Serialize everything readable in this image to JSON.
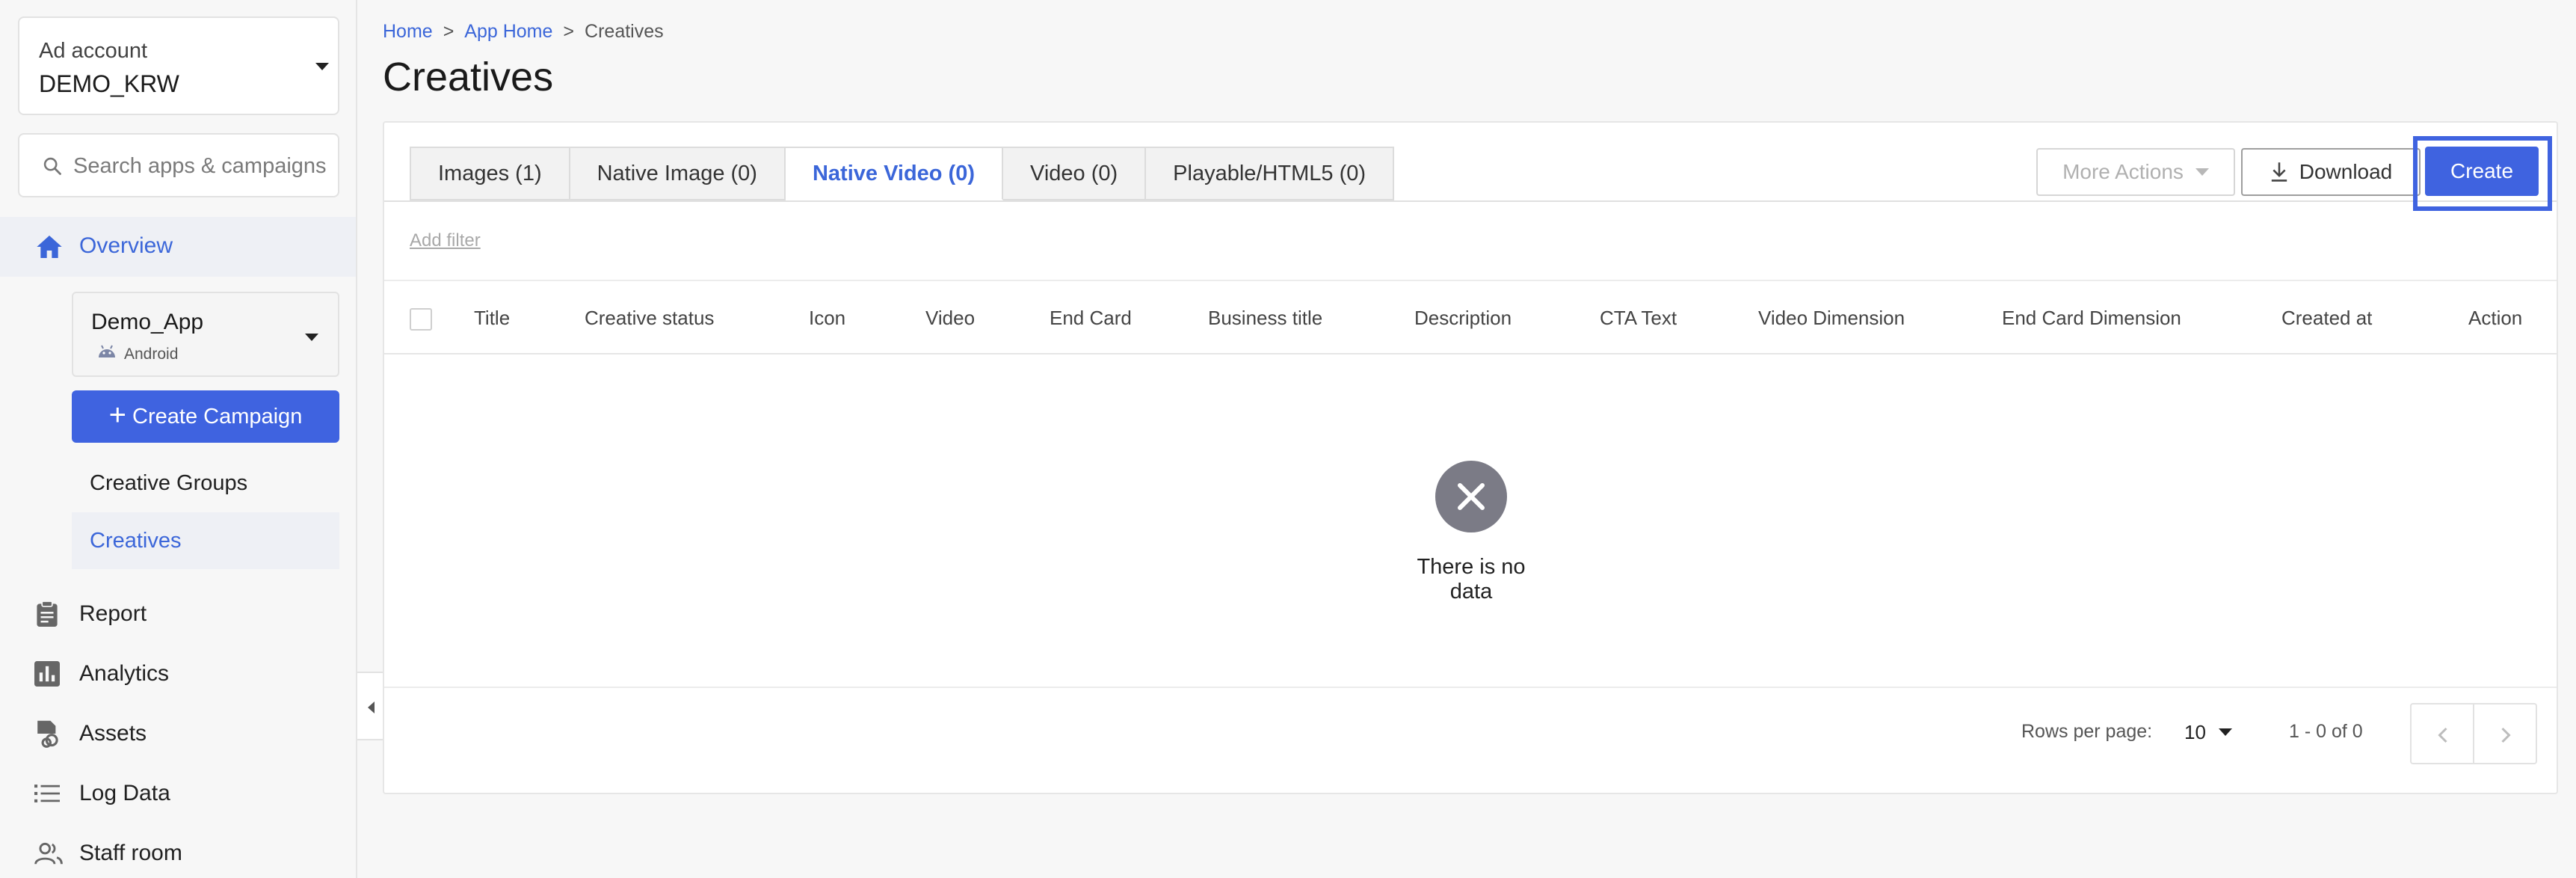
{
  "sidebar": {
    "account_label": "Ad account",
    "account_value": "DEMO_KRW",
    "search_placeholder": "Search apps & campaigns",
    "overview": "Overview",
    "app": {
      "name": "Demo_App",
      "platform": "Android"
    },
    "create_campaign": "Create Campaign",
    "sub_items": [
      "Creative Groups",
      "Creatives"
    ],
    "nav": [
      "Report",
      "Analytics",
      "Assets",
      "Log Data",
      "Staff room"
    ]
  },
  "breadcrumb": [
    "Home",
    "App Home",
    "Creatives"
  ],
  "breadcrumb_sep": ">",
  "page_title": "Creatives",
  "tabs": [
    {
      "label": "Images (1)",
      "active": false
    },
    {
      "label": "Native Image (0)",
      "active": false
    },
    {
      "label": "Native Video (0)",
      "active": true
    },
    {
      "label": "Video (0)",
      "active": false
    },
    {
      "label": "Playable/HTML5 (0)",
      "active": false
    }
  ],
  "actions": {
    "more": "More Actions",
    "download": "Download",
    "create": "Create"
  },
  "add_filter": "Add filter",
  "columns": [
    "Title",
    "Creative status",
    "Icon",
    "Video",
    "End Card",
    "Business title",
    "Description",
    "CTA Text",
    "Video Dimension",
    "End Card Dimension",
    "Created at",
    "Action"
  ],
  "empty_message": "There is no data",
  "pagination": {
    "rows_per_page_label": "Rows per page:",
    "rows_per_page": "10",
    "range": "1 - 0 of 0"
  },
  "colors": {
    "accent": "#3f63e0",
    "link": "#3b66d9"
  }
}
